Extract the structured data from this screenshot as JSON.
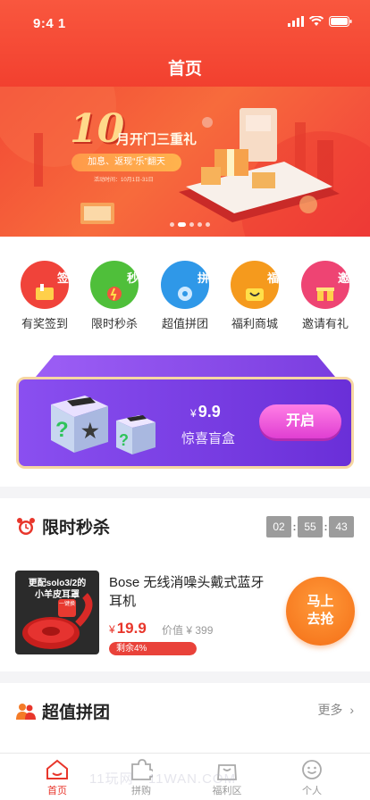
{
  "status": {
    "time": "9:4 1"
  },
  "header": {
    "title": "首页"
  },
  "banner": {
    "big_number": "10",
    "title": "月开门三重礼",
    "subtitle": "加息、返现“乐”翻天",
    "date": "活动时间：10月1日-31日"
  },
  "quick_links": [
    {
      "icon_text": "签到",
      "label": "有奖签到",
      "color": "#f0433a"
    },
    {
      "icon_text": "秒杀",
      "label": "限时秒杀",
      "color": "#4fbf3a"
    },
    {
      "icon_text": "拼团",
      "label": "超值拼团",
      "color": "#2f98e8"
    },
    {
      "icon_text": "福利",
      "label": "福利商城",
      "color": "#f59a1d"
    },
    {
      "icon_text": "邀请",
      "label": "邀请有礼",
      "color": "#ee4473"
    }
  ],
  "blind_box": {
    "currency": "¥",
    "price": "9.9",
    "name": "惊喜盲盒",
    "button": "开启"
  },
  "flash_sale": {
    "title": "限时秒杀",
    "countdown": [
      "02",
      "55",
      "43"
    ],
    "product": {
      "image_text1": "更配solo3/2的",
      "image_text2": "小羊皮耳罩",
      "image_badge": "一键换",
      "name": "Bose 无线消噪头戴式蓝牙耳机",
      "currency": "¥",
      "price": "19.9",
      "original_price": "价值 ¥ 399",
      "stock_text": "剩余4%",
      "stock_percent": 4,
      "buy_button": "马上去抢"
    }
  },
  "group_buy": {
    "title": "超值拼团",
    "more": "更多"
  },
  "tabbar": [
    {
      "label": "首页",
      "icon": "home-icon",
      "active": true
    },
    {
      "label": "拼购",
      "icon": "puzzle-icon",
      "active": false
    },
    {
      "label": "福利区",
      "icon": "shopping-bag-icon",
      "active": false
    },
    {
      "label": "个人",
      "icon": "smiley-icon",
      "active": false
    }
  ],
  "watermark": "11玩网 · 11WAN.COM",
  "colors": {
    "brand_red": "#f2402f",
    "price_red": "#e8362b",
    "buy_orange": "#f46e16",
    "blind_purple": "#7b3ee0"
  }
}
